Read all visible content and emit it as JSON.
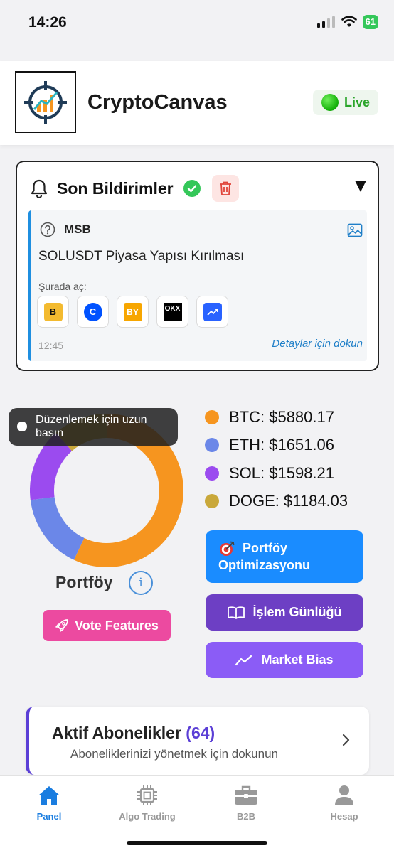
{
  "status_bar": {
    "time": "14:26",
    "battery": "61"
  },
  "header": {
    "title": "CryptoCanvas",
    "live_label": "Live"
  },
  "notifications": {
    "title": "Son Bildirimler",
    "item": {
      "source": "MSB",
      "message": "SOLUSDT Piyasa Yapısı Kırılması",
      "open_in_label": "Şurada aç:",
      "exchanges": [
        {
          "name": "binance",
          "label": "B",
          "color": "#f3ba2f"
        },
        {
          "name": "coinbase",
          "label": "C",
          "color": "#0052ff"
        },
        {
          "name": "bybit",
          "label": "BY",
          "color": "#f7a600"
        },
        {
          "name": "okx",
          "label": "OKX",
          "color": "#000000"
        },
        {
          "name": "tradingview",
          "label": "",
          "color": "#2962ff"
        }
      ],
      "time": "12:45",
      "detail_hint": "Detaylar için dokun"
    }
  },
  "portfolio": {
    "tooltip": "Düzenlemek için uzun basın",
    "label": "Portföy",
    "vote_button": "Vote Features",
    "holdings": [
      {
        "symbol": "BTC",
        "text": "BTC: $5880.17",
        "value": 5880.17,
        "color": "#f6951f"
      },
      {
        "symbol": "ETH",
        "text": "ETH: $1651.06",
        "value": 1651.06,
        "color": "#6b87e8"
      },
      {
        "symbol": "SOL",
        "text": "SOL: $1598.21",
        "value": 1598.21,
        "color": "#9b4bef"
      },
      {
        "symbol": "DOGE",
        "text": "DOGE: $1184.03",
        "value": 1184.03,
        "color": "#c9a83a"
      }
    ]
  },
  "actions": {
    "optimize_line1": "Portföy",
    "optimize_line2": "Optimizasyonu",
    "journal": "İşlem Günlüğü",
    "market_bias": "Market Bias"
  },
  "subscriptions": {
    "title": "Aktif Abonelikler",
    "count": "(64)",
    "subtitle": "Aboneliklerinizi yönetmek için dokunun"
  },
  "tabs": [
    {
      "label": "Panel",
      "icon": "home-icon",
      "active": true
    },
    {
      "label": "Algo Trading",
      "icon": "chip-icon",
      "active": false
    },
    {
      "label": "B2B",
      "icon": "briefcase-icon",
      "active": false
    },
    {
      "label": "Hesap",
      "icon": "user-icon",
      "active": false
    }
  ]
}
